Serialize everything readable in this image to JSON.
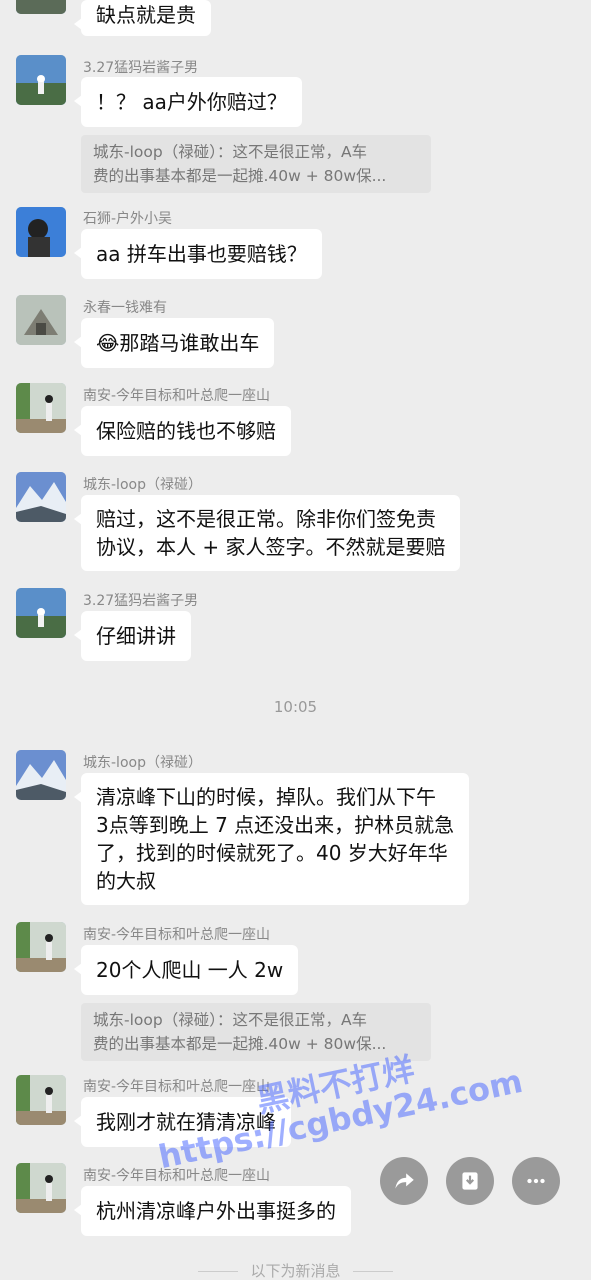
{
  "messages": [
    {
      "bubble": "缺点就是贵"
    },
    {
      "name": "3.27猛犸岩酱子男",
      "bubble": "！？ aa户外你赔过？",
      "quote": [
        "城东-loop（禄碰）：这不是很正常，A车",
        "费的出事基本都是一起摊.40w + 80w保..."
      ]
    },
    {
      "name": "石狮-户外小吴",
      "bubble": "aa 拼车出事也要赔钱？"
    },
    {
      "name": "永春一钱难有",
      "bubble": "😂那踏马谁敢出车"
    },
    {
      "name": "南安-今年目标和叶总爬一座山",
      "bubble": "保险赔的钱也不够赔"
    },
    {
      "name": "城东-loop（禄碰）",
      "bubble_lines": [
        "赔过，这不是很正常。除非你们签免责",
        "协议，本人 + 家人签字。不然就是要赔"
      ]
    },
    {
      "name": "3.27猛犸岩酱子男",
      "bubble": "仔细讲讲"
    },
    {
      "name": "城东-loop（禄碰）",
      "bubble_lines": [
        "清凉峰下山的时候，掉队。我们从下午",
        "3点等到晚上 7 点还没出来，护林员就急",
        "了，找到的时候就死了。40 岁大好年华",
        "的大叔"
      ]
    },
    {
      "name": "南安-今年目标和叶总爬一座山",
      "bubble": "20个人爬山 一人 2w",
      "quote": [
        "城东-loop（禄碰）：这不是很正常，A车",
        "费的出事基本都是一起摊.40w + 80w保..."
      ]
    },
    {
      "name": "南安-今年目标和叶总爬一座山",
      "bubble": "我刚才就在猜清凉峰"
    },
    {
      "name": "南安-今年目标和叶总爬一座山",
      "bubble": "杭州清凉峰户外出事挺多的"
    }
  ],
  "time_label": "10:05",
  "new_messages_divider": "以下为新消息",
  "actions": {
    "share": "share-icon",
    "save": "save-icon",
    "more": "more-icon"
  },
  "watermark": {
    "line1": "黑料不打烊",
    "line2": "https://cgbdy24.com"
  }
}
